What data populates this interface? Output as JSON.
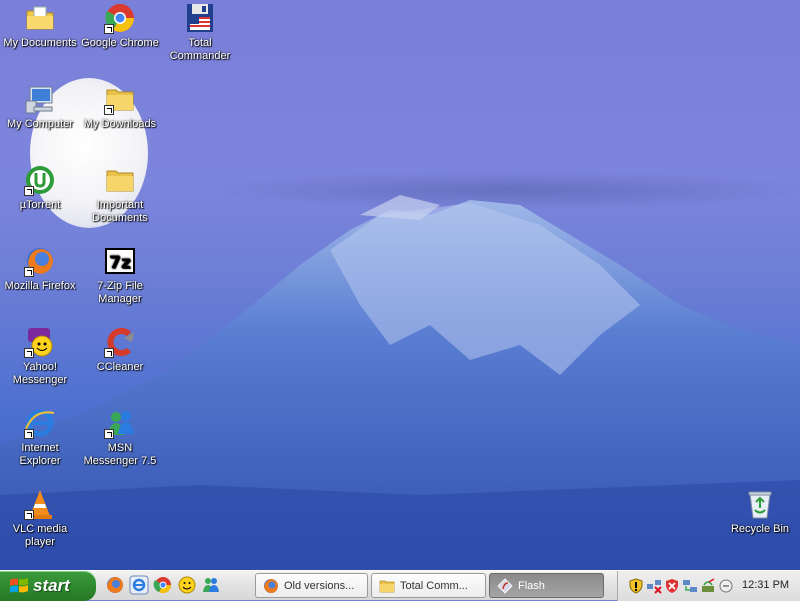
{
  "desktop_icons": [
    {
      "label": "My Documents"
    },
    {
      "label": "Google Chrome"
    },
    {
      "label": "Total Commander"
    },
    {
      "label": "My Computer"
    },
    {
      "label": "My Downloads"
    },
    {
      "label": "µTorrent"
    },
    {
      "label": "Important Documents"
    },
    {
      "label": "Mozilla Firefox"
    },
    {
      "label": "7-Zip File Manager"
    },
    {
      "label": "Yahoo! Messenger"
    },
    {
      "label": "CCleaner"
    },
    {
      "label": "Internet Explorer"
    },
    {
      "label": "MSN Messenger 7.5"
    },
    {
      "label": "VLC media player"
    },
    {
      "label": "Recycle Bin"
    }
  ],
  "taskbar": {
    "start_label": "start",
    "tasks": [
      {
        "label": "Old versions..."
      },
      {
        "label": "Total Comm..."
      },
      {
        "label": "Flash"
      }
    ],
    "clock": "12:31 PM"
  },
  "colors": {
    "sky": "#7a7fd8",
    "mountain": "#3c5fc4",
    "start_green": "#2f8a2f"
  }
}
